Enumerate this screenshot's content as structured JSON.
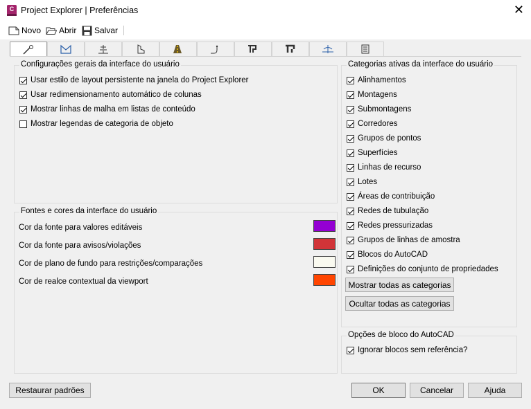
{
  "window": {
    "title": "Project Explorer | Preferências",
    "app_icon_letter": "C",
    "close_glyph": "✕"
  },
  "toolbar": {
    "new_label": "Novo",
    "open_label": "Abrir",
    "save_label": "Salvar"
  },
  "tabs": [
    {
      "icon": "wrench-icon"
    },
    {
      "icon": "surface-icon"
    },
    {
      "icon": "assembly-icon"
    },
    {
      "icon": "parcel-icon"
    },
    {
      "icon": "corridor-icon"
    },
    {
      "icon": "alignment-icon"
    },
    {
      "icon": "pipe-network-icon"
    },
    {
      "icon": "pressure-network-icon"
    },
    {
      "icon": "sample-line-icon"
    },
    {
      "icon": "property-set-icon"
    }
  ],
  "general": {
    "title": "Configurações gerais da interface do usuário",
    "options": [
      {
        "label": "Usar estilo de layout persistente na janela do Project Explorer",
        "checked": true
      },
      {
        "label": "Usar redimensionamento automático de colunas",
        "checked": true
      },
      {
        "label": "Mostrar linhas de malha em listas de conteúdo",
        "checked": true
      },
      {
        "label": "Mostrar legendas de categoria de objeto",
        "checked": false
      }
    ]
  },
  "fonts": {
    "title": "Fontes e cores da interface do usuário",
    "rows": [
      {
        "label": "Cor da fonte para valores editáveis",
        "color": "#9400d3"
      },
      {
        "label": "Cor da fonte para avisos/violações",
        "color": "#d13438"
      },
      {
        "label": "Cor de plano de fundo para restrições/comparações",
        "color": "#fafaf0"
      },
      {
        "label": "Cor de realce contextual da viewport",
        "color": "#ff4500"
      }
    ]
  },
  "categories": {
    "title": "Categorias ativas da interface do usuário",
    "items": [
      {
        "label": "Alinhamentos",
        "checked": true
      },
      {
        "label": "Montagens",
        "checked": true
      },
      {
        "label": "Submontagens",
        "checked": true
      },
      {
        "label": "Corredores",
        "checked": true
      },
      {
        "label": "Grupos de pontos",
        "checked": true
      },
      {
        "label": "Superfícies",
        "checked": true
      },
      {
        "label": "Linhas de recurso",
        "checked": true
      },
      {
        "label": "Lotes",
        "checked": true
      },
      {
        "label": "Áreas de contribuição",
        "checked": true
      },
      {
        "label": "Redes de tubulação",
        "checked": true
      },
      {
        "label": "Redes pressurizadas",
        "checked": true
      },
      {
        "label": "Grupos de linhas de amostra",
        "checked": true
      },
      {
        "label": "Blocos do AutoCAD",
        "checked": true
      },
      {
        "label": "Definições do conjunto de propriedades",
        "checked": true
      }
    ],
    "show_all_label": "Mostrar todas as categorias",
    "hide_all_label": "Ocultar todas as categorias"
  },
  "block_options": {
    "title": "Opções de bloco do AutoCAD",
    "option": {
      "label": "Ignorar blocos sem referência?",
      "checked": true
    }
  },
  "footer": {
    "restore_label": "Restaurar padrões",
    "ok_label": "OK",
    "cancel_label": "Cancelar",
    "help_label": "Ajuda"
  }
}
